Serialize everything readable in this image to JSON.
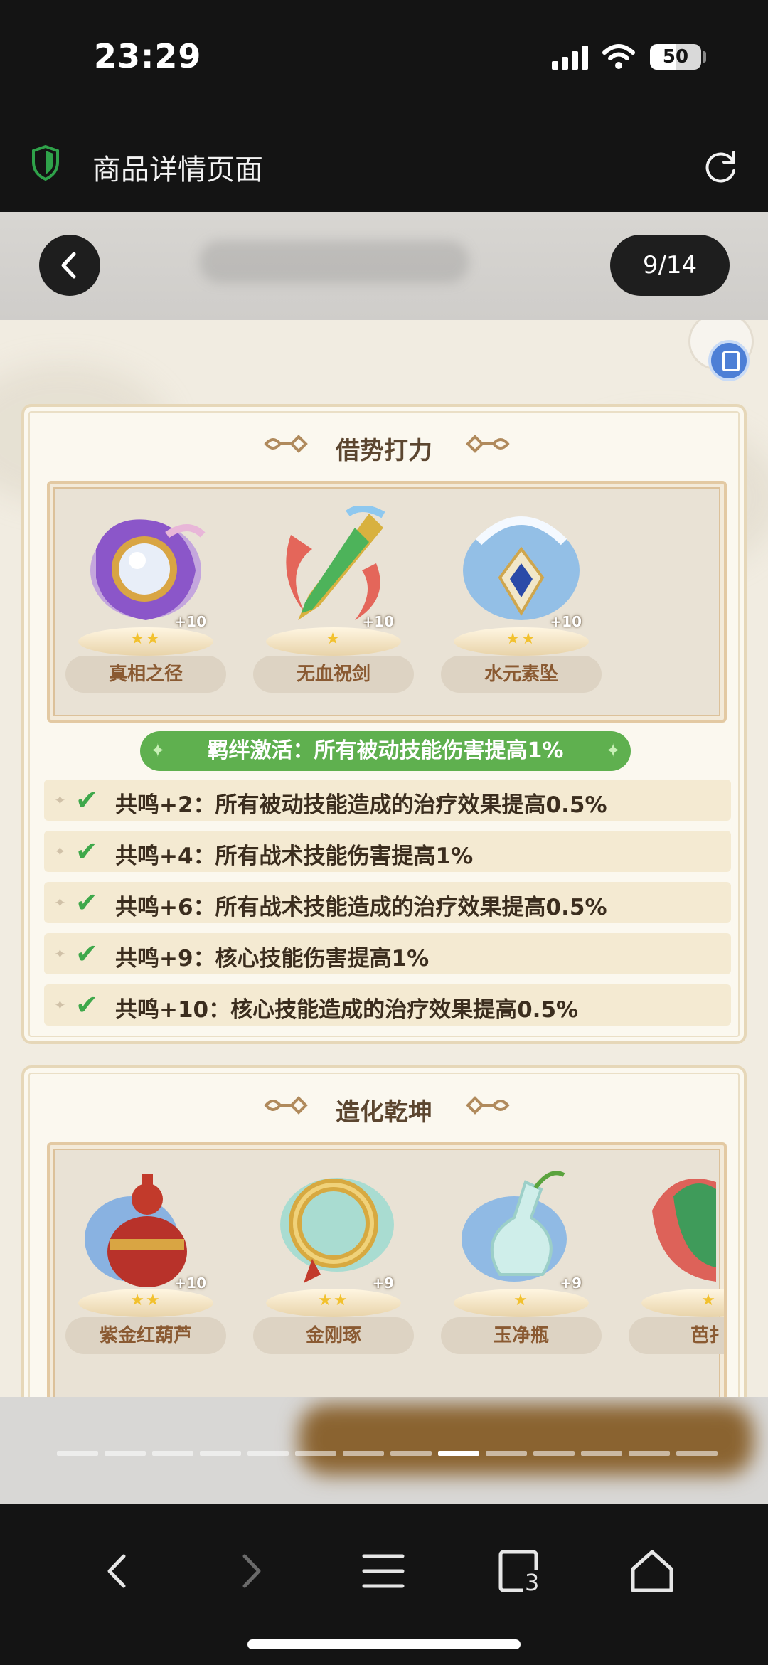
{
  "status_bar": {
    "time": "23:29",
    "battery": "50"
  },
  "browser": {
    "title": "商品详情页面"
  },
  "viewer": {
    "page_counter": "9/14",
    "total_pages": 14,
    "current_page": 9
  },
  "panel1": {
    "title": "借势打力",
    "items": [
      {
        "name": "真相之径",
        "level": "+10",
        "stars": "★★"
      },
      {
        "name": "无血祝剑",
        "level": "+10",
        "stars": "★"
      },
      {
        "name": "水元素坠",
        "level": "+10",
        "stars": "★★"
      }
    ],
    "bond": "羁绊激活：所有被动技能伤害提高1%",
    "resonances": [
      "共鸣+2：所有被动技能造成的治疗效果提高0.5%",
      "共鸣+4：所有战术技能伤害提高1%",
      "共鸣+6：所有战术技能造成的治疗效果提高0.5%",
      "共鸣+9：核心技能伤害提高1%",
      "共鸣+10：核心技能造成的治疗效果提高0.5%"
    ]
  },
  "panel2": {
    "title": "造化乾坤",
    "items": [
      {
        "name": "紫金红葫芦",
        "level": "+10",
        "stars": "★★"
      },
      {
        "name": "金刚琢",
        "level": "+9",
        "stars": "★★"
      },
      {
        "name": "玉净瓶",
        "level": "+9",
        "stars": "★"
      },
      {
        "name": "芭扌",
        "level": "",
        "stars": "★"
      }
    ]
  },
  "icons": {
    "shield": "shield-icon",
    "reload": "reload-icon",
    "back": "chevron-left-icon",
    "nav": [
      "back-arrow-icon",
      "forward-arrow-icon",
      "menu-icon",
      "tabs-icon",
      "home-icon"
    ],
    "tabs_count": "3"
  },
  "colors": {
    "accent_green": "#5fb04f",
    "check_green": "#3fa84b",
    "panel_text": "#5c4630",
    "item_name": "#8a5a32"
  }
}
